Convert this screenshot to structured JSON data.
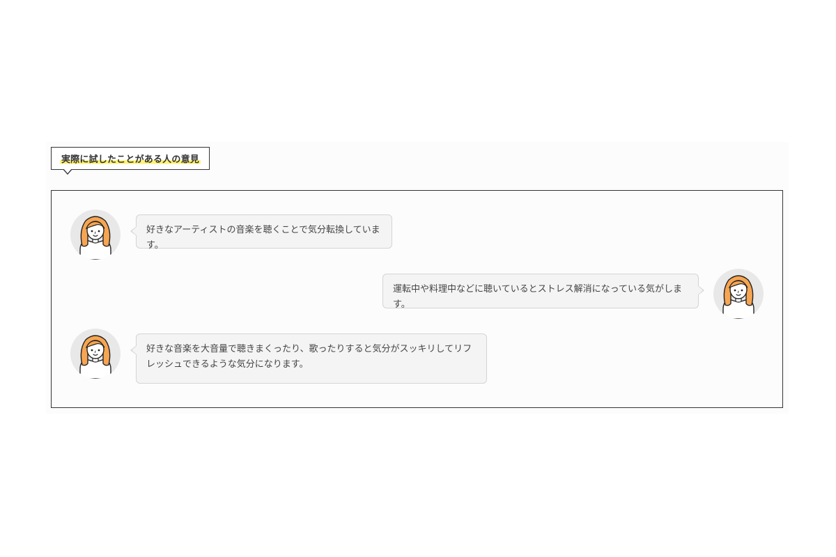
{
  "heading": {
    "title": "実際に試したことがある人の意見",
    "highlight_color": "#fff27a"
  },
  "messages": [
    {
      "side": "left",
      "avatar": "woman-avatar-icon",
      "text": "好きなアーティストの音楽を聴くことで気分転換しています。"
    },
    {
      "side": "right",
      "avatar": "woman-avatar-icon",
      "text": "運転中や料理中などに聴いているとストレス解消になっている気がします。"
    },
    {
      "side": "left",
      "avatar": "woman-avatar-icon",
      "text": "好きな音楽を大音量で聴きまくったり、歌ったりすると気分がスッキリしてリフレッシュできるような気分になります。"
    }
  ],
  "colors": {
    "hair": "#f6a552",
    "avatar_bg": "#e8e8e8",
    "bubble_bg": "#f4f4f4",
    "bubble_border": "#d4d4d4"
  }
}
